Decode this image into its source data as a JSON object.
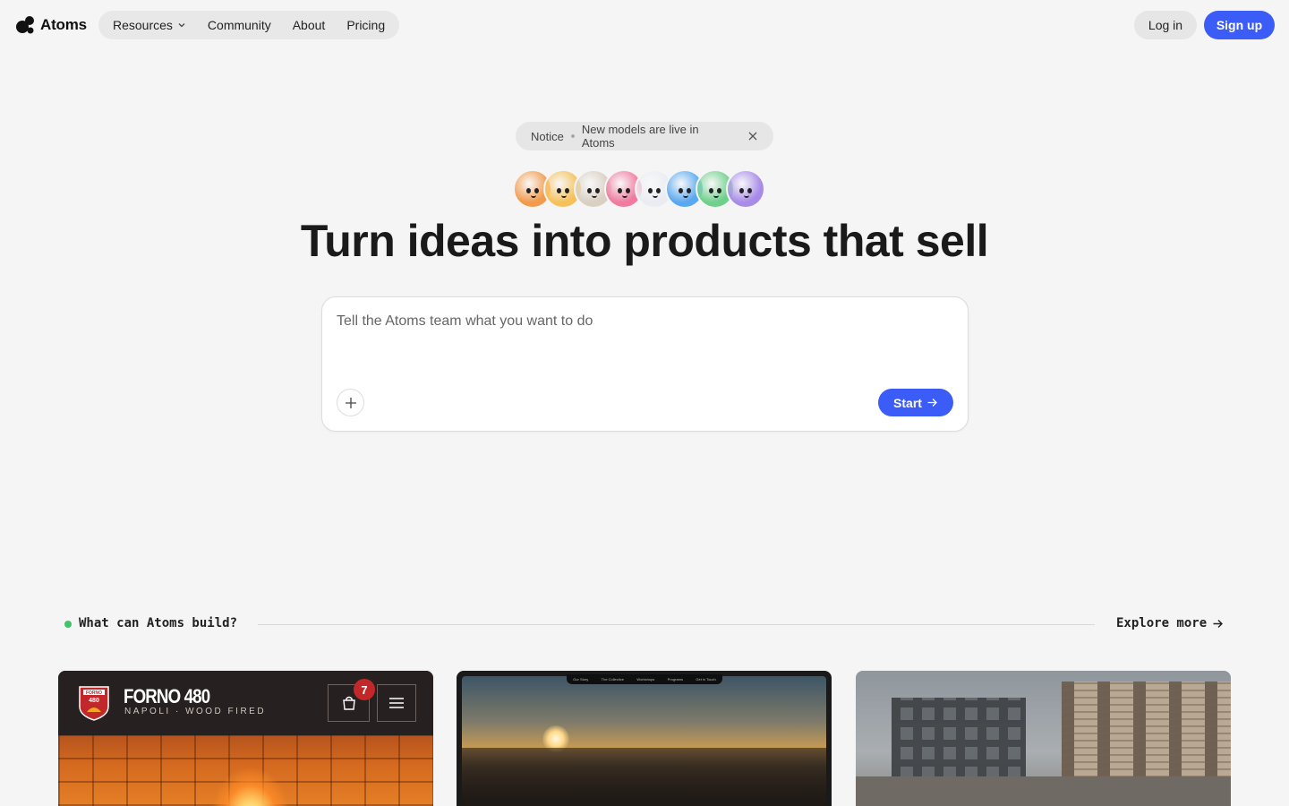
{
  "brand": {
    "name": "Atoms"
  },
  "nav": {
    "items": [
      {
        "label": "Resources",
        "has_dropdown": true
      },
      {
        "label": "Community"
      },
      {
        "label": "About"
      },
      {
        "label": "Pricing"
      }
    ],
    "login_label": "Log in",
    "signup_label": "Sign up"
  },
  "notice": {
    "tag": "Notice",
    "message": "New models are live in Atoms"
  },
  "team_avatars": [
    {
      "name": "avatar-orange",
      "color": "#f29b4c"
    },
    {
      "name": "avatar-yellow",
      "color": "#f5c15a"
    },
    {
      "name": "avatar-beige",
      "color": "#d9cfc2"
    },
    {
      "name": "avatar-pink",
      "color": "#f07aa0"
    },
    {
      "name": "avatar-white",
      "color": "#e9ecf2"
    },
    {
      "name": "avatar-blue",
      "color": "#5aa8f0"
    },
    {
      "name": "avatar-green",
      "color": "#6fd08c"
    },
    {
      "name": "avatar-purple",
      "color": "#a88be8"
    }
  ],
  "hero": {
    "headline": "Turn ideas into products that sell"
  },
  "prompt": {
    "placeholder": "Tell the Atoms team what you want to do",
    "value": "",
    "start_label": "Start"
  },
  "showcase": {
    "title": "What can Atoms build?",
    "explore_label": "Explore more",
    "cards": [
      {
        "name": "FORNO 480",
        "subtitle": "NAPOLI · WOOD FIRED",
        "cart_count": "7",
        "badge_text": "FORNO",
        "badge_number": "480"
      },
      {
        "nav_items": [
          "Our Story",
          "The Collective",
          "Workshops",
          "Programs",
          "Get in Touch"
        ]
      },
      {}
    ]
  },
  "colors": {
    "accent": "#3b5cf6",
    "background": "#f5f5f5",
    "status_dot": "#3fc46a"
  }
}
